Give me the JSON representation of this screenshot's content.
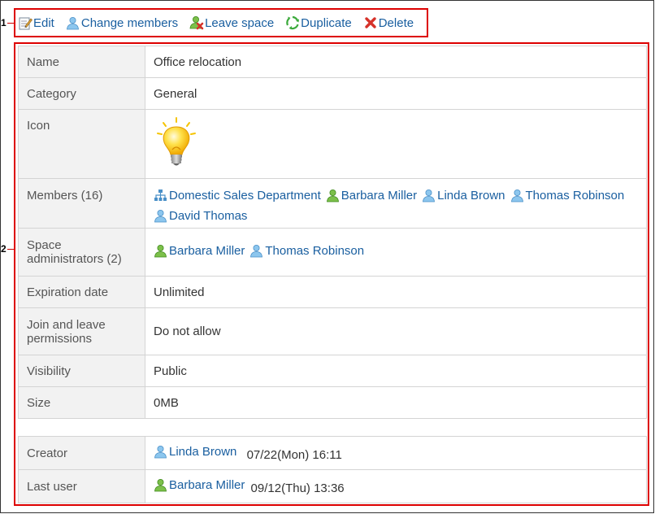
{
  "callouts": {
    "one": "1",
    "two": "2"
  },
  "toolbar": {
    "edit": "Edit",
    "change_members": "Change members",
    "leave_space": "Leave space",
    "duplicate": "Duplicate",
    "delete": "Delete"
  },
  "details": {
    "name": {
      "label": "Name",
      "value": "Office relocation"
    },
    "category": {
      "label": "Category",
      "value": "General"
    },
    "icon": {
      "label": "Icon",
      "icon_name": "lightbulb-icon"
    },
    "members": {
      "label": "Members (16)",
      "items": [
        {
          "name": "Domestic Sales Department",
          "type": "org"
        },
        {
          "name": "Barbara Miller",
          "type": "admin"
        },
        {
          "name": "Linda Brown",
          "type": "user"
        },
        {
          "name": "Thomas Robinson",
          "type": "user"
        },
        {
          "name": "David Thomas",
          "type": "user"
        }
      ]
    },
    "space_admins": {
      "label": "Space administrators (2)",
      "items": [
        {
          "name": "Barbara Miller",
          "type": "admin"
        },
        {
          "name": "Thomas Robinson",
          "type": "user"
        }
      ]
    },
    "expiration": {
      "label": "Expiration date",
      "value": "Unlimited"
    },
    "join_leave": {
      "label": "Join and leave permissions",
      "value": "Do not allow"
    },
    "visibility": {
      "label": "Visibility",
      "value": "Public"
    },
    "size": {
      "label": "Size",
      "value": "0MB"
    },
    "creator": {
      "label": "Creator",
      "user": "Linda Brown",
      "timestamp": "07/22(Mon) 16:11"
    },
    "last_user": {
      "label": "Last user",
      "user": "Barbara Miller",
      "timestamp": "09/12(Thu) 13:36"
    }
  },
  "colors": {
    "link": "#1a5fa0",
    "callout_red": "#dd0000",
    "label_bg": "#f2f2f2"
  }
}
